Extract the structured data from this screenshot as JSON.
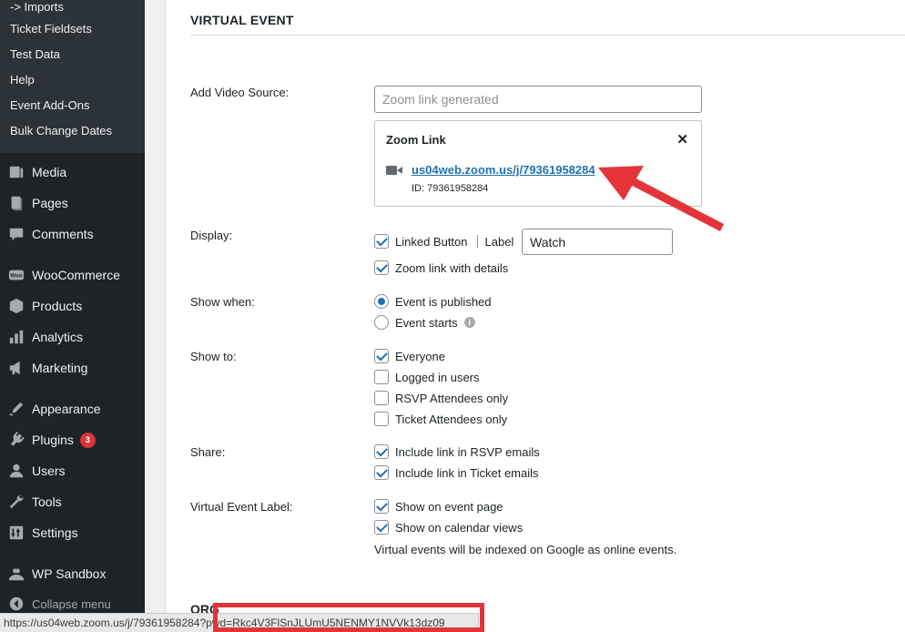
{
  "sidebar": {
    "submenu": [
      "-> Imports",
      "Ticket Fieldsets",
      "Test Data",
      "Help",
      "Event Add-Ons",
      "Bulk Change Dates"
    ],
    "items": [
      {
        "label": "Media",
        "icon": "media-icon"
      },
      {
        "label": "Pages",
        "icon": "pages-icon"
      },
      {
        "label": "Comments",
        "icon": "comments-icon"
      },
      {
        "label": "WooCommerce",
        "icon": "woocommerce-icon"
      },
      {
        "label": "Products",
        "icon": "products-icon"
      },
      {
        "label": "Analytics",
        "icon": "analytics-icon"
      },
      {
        "label": "Marketing",
        "icon": "marketing-icon"
      },
      {
        "label": "Appearance",
        "icon": "appearance-icon"
      },
      {
        "label": "Plugins",
        "icon": "plugins-icon",
        "badge": "3"
      },
      {
        "label": "Users",
        "icon": "users-icon"
      },
      {
        "label": "Tools",
        "icon": "tools-icon"
      },
      {
        "label": "Settings",
        "icon": "settings-icon"
      },
      {
        "label": "WP Sandbox",
        "icon": "sandbox-icon"
      }
    ],
    "collapse_label": "Collapse menu"
  },
  "main": {
    "section_title": "VIRTUAL EVENT",
    "video_source": {
      "label": "Add Video Source:",
      "placeholder": "Zoom link generated",
      "zoom_box": {
        "title": "Zoom Link",
        "close": "✕",
        "link": "us04web.zoom.us/j/79361958284",
        "id_text": "ID: 79361958284"
      }
    },
    "display": {
      "label": "Display:",
      "linked_button": "Linked Button",
      "label_text": "Label",
      "button_label_value": "Watch",
      "zoom_details": "Zoom link with details"
    },
    "show_when": {
      "label": "Show when:",
      "options": [
        "Event is published",
        "Event starts"
      ]
    },
    "show_to": {
      "label": "Show to:",
      "options": [
        "Everyone",
        "Logged in users",
        "RSVP Attendees only",
        "Ticket Attendees only"
      ]
    },
    "share": {
      "label": "Share:",
      "options": [
        "Include link in RSVP emails",
        "Include link in Ticket emails"
      ]
    },
    "virtual_label": {
      "label": "Virtual Event Label:",
      "options": [
        "Show on event page",
        "Show on calendar views"
      ],
      "note": "Virtual events will be indexed on Google as online events."
    },
    "next_section": "ORG"
  },
  "statusbar": {
    "url": "https://us04web.zoom.us/j/79361958284?pwd=Rkc4V3FlSnJLUmU5NENMY1NVVk13dz09"
  },
  "colors": {
    "accent": "#2271b1",
    "annotation": "#e4343a",
    "sidebar": "#1d2327"
  }
}
